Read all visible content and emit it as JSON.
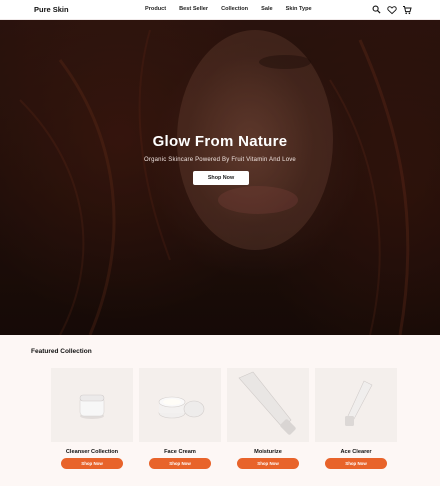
{
  "header": {
    "brand": "Pure Skin",
    "nav": [
      "Product",
      "Best Seller",
      "Collection",
      "Sale",
      "Skin Type"
    ],
    "icons": [
      "search-icon",
      "heart-icon",
      "cart-icon"
    ]
  },
  "hero": {
    "title": "Glow From Nature",
    "subtitle": "Organic Skincare Powered By Fruit Vitamin And Love",
    "button_label": "Shop Now"
  },
  "featured": {
    "title": "Featured Collection",
    "products": [
      {
        "name": "Cleanser Collection",
        "button_label": "Shop Now",
        "image": "jar-icon"
      },
      {
        "name": "Face Cream",
        "button_label": "Shop Now",
        "image": "cream-jars-icon"
      },
      {
        "name": "Moisturize",
        "button_label": "Shop Now",
        "image": "tube-icon"
      },
      {
        "name": "Ace Clearer",
        "button_label": "Shop Now",
        "image": "tube-small-icon"
      }
    ]
  },
  "colors": {
    "accent": "#e8632a",
    "hero_bg": "#2a130d",
    "page_bg": "#fdf7f5"
  }
}
